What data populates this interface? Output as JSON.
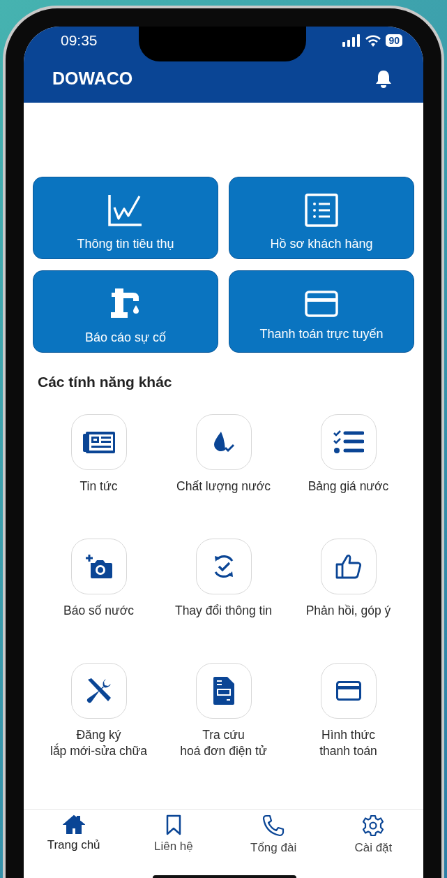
{
  "status_bar": {
    "time": "09:35",
    "battery": "90"
  },
  "header": {
    "title": "DOWACO"
  },
  "main_tiles": [
    {
      "label": "Thông tin tiêu thụ"
    },
    {
      "label": "Hồ sơ khách hàng"
    },
    {
      "label": "Báo cáo sự cố"
    },
    {
      "label": "Thanh toán trực tuyến"
    }
  ],
  "section_title": "Các tính năng khác",
  "features": [
    {
      "lines": [
        "Tin tức"
      ]
    },
    {
      "lines": [
        "Chất lượng nước"
      ]
    },
    {
      "lines": [
        "Bảng giá nước"
      ]
    },
    {
      "lines": [
        "Báo số nước"
      ]
    },
    {
      "lines": [
        "Thay đổi thông tin"
      ]
    },
    {
      "lines": [
        "Phản hồi, góp ý"
      ]
    },
    {
      "lines": [
        "Đăng ký",
        "lắp mới-sửa chữa"
      ]
    },
    {
      "lines": [
        "Tra cứu",
        "hoá đơn điện tử"
      ]
    },
    {
      "lines": [
        "Hình thức",
        "thanh toán"
      ]
    }
  ],
  "tabs": [
    {
      "label": "Trang chủ",
      "selected": true
    },
    {
      "label": "Liên hệ",
      "selected": false
    },
    {
      "label": "Tổng đài",
      "selected": false
    },
    {
      "label": "Cài đặt",
      "selected": false
    }
  ]
}
